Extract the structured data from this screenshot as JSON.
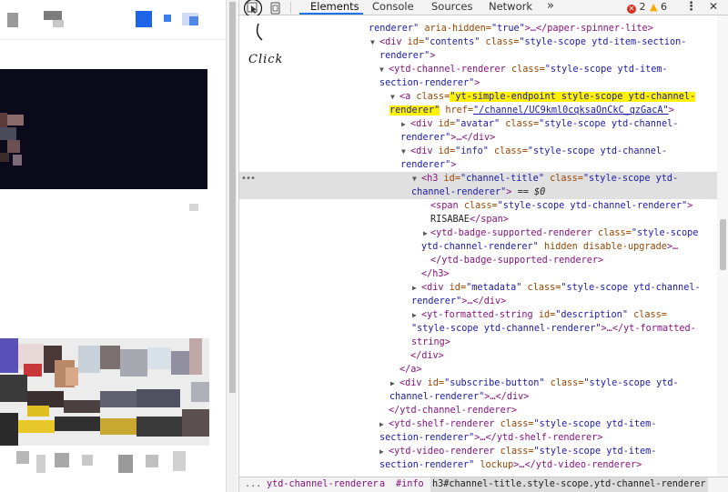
{
  "devtools": {
    "tabs": [
      "Elements",
      "Console",
      "Sources",
      "Network"
    ],
    "more_label": "»",
    "error_count": "2",
    "warning_count": "6",
    "menu_label": "⋮",
    "close_label": "✕",
    "annotation_text": "Click",
    "selected_marker": "== $0"
  },
  "elements": {
    "l01": {
      "t1": "renderer\"",
      "a1": " aria-hidden=",
      "v1": "\"true\"",
      "t2": ">…</paper-spinner-lite>"
    },
    "l02": {
      "t1": "<div ",
      "a1": "id=",
      "v1": "\"contents\"",
      "a2": " class=",
      "v2": "\"style-scope ytd-item-section-"
    },
    "l03": {
      "v1": "renderer\"",
      "t1": ">"
    },
    "l04": {
      "t1": "<ytd-channel-renderer ",
      "a1": "class=",
      "v1": "\"style-scope ytd-item-"
    },
    "l05": {
      "v1": "section-renderer\"",
      "t1": ">"
    },
    "l06": {
      "t1": "<a ",
      "a1": "class=",
      "v1": "\"yt-simple-endpoint style-scope ytd-channel-"
    },
    "l07": {
      "v1": "renderer\"",
      "a1": " href=",
      "v2": "\"/channel/UC9kml0cqksaOnCkC_qzGacA\"",
      "t1": ">"
    },
    "l08": {
      "t1": "<div ",
      "a1": "id=",
      "v1": "\"avatar\"",
      "a2": " class=",
      "v2": "\"style-scope ytd-channel-"
    },
    "l09": {
      "v1": "renderer\"",
      "t1": ">…</div>"
    },
    "l10": {
      "t1": "<div ",
      "a1": "id=",
      "v1": "\"info\"",
      "a2": " class=",
      "v2": "\"style-scope ytd-channel-"
    },
    "l11": {
      "v1": "renderer\"",
      "t1": ">"
    },
    "l12": {
      "t1": "<h3 ",
      "a1": "id=",
      "v1": "\"channel-title\"",
      "a2": " class=",
      "v2": "\"style-scope ytd-"
    },
    "l13": {
      "v1": "channel-renderer\"",
      "t1": ">"
    },
    "l14": {
      "t1": "<span ",
      "a1": "class=",
      "v1": "\"style-scope ytd-channel-renderer\"",
      "t2": ">"
    },
    "l15": {
      "p1": "RISABAE",
      "t1": "</span>"
    },
    "l16": {
      "t1": "<ytd-badge-supported-renderer ",
      "a1": "class=",
      "v1": "\"style-scope"
    },
    "l17": {
      "v1": "ytd-channel-renderer\"",
      "a1": " hidden disable-upgrade",
      "t1": ">…"
    },
    "l18": {
      "t1": "</ytd-badge-supported-renderer>"
    },
    "l19": {
      "t1": "</h3>"
    },
    "l20": {
      "t1": "<div ",
      "a1": "id=",
      "v1": "\"metadata\"",
      "a2": " class=",
      "v2": "\"style-scope ytd-channel-"
    },
    "l21": {
      "v1": "renderer\"",
      "t1": ">…</div>"
    },
    "l22": {
      "t1": "<yt-formatted-string ",
      "a1": "id=",
      "v1": "\"description\"",
      "a2": " class="
    },
    "l23": {
      "v1": "\"style-scope ytd-channel-renderer\"",
      "t1": ">…</yt-formatted-"
    },
    "l24": {
      "t1": "string>"
    },
    "l25": {
      "t1": "</div>"
    },
    "l26": {
      "t1": "</a>"
    },
    "l27": {
      "t1": "<div ",
      "a1": "id=",
      "v1": "\"subscribe-button\"",
      "a2": " class=",
      "v2": "\"style-scope ytd-"
    },
    "l28": {
      "v1": "channel-renderer\"",
      "t1": ">…</div>"
    },
    "l29": {
      "t1": "</ytd-channel-renderer>"
    },
    "l30": {
      "t1": "<ytd-shelf-renderer ",
      "a1": "class=",
      "v1": "\"style-scope ytd-item-"
    },
    "l31": {
      "v1": "section-renderer\"",
      "t1": ">…</ytd-shelf-renderer>"
    },
    "l32": {
      "t1": "<ytd-video-renderer ",
      "a1": "class=",
      "v1": "\"style-scope ytd-item-"
    },
    "l33": {
      "v1": "section-renderer\"",
      "a1": " lockup",
      "t1": ">…</ytd-video-renderer>"
    }
  },
  "breadcrumb": [
    "...",
    "ytd-channel-renderer",
    "a",
    "#info",
    "h3#channel-title.style-scope.ytd-channel-renderer"
  ],
  "colors": {
    "tag": "#881280",
    "attr": "#994500",
    "value": "#1a1aa6",
    "highlight": "#fff200",
    "tab_accent": "#1a73e8",
    "error": "#d93025",
    "warning": "#f9ab00"
  }
}
